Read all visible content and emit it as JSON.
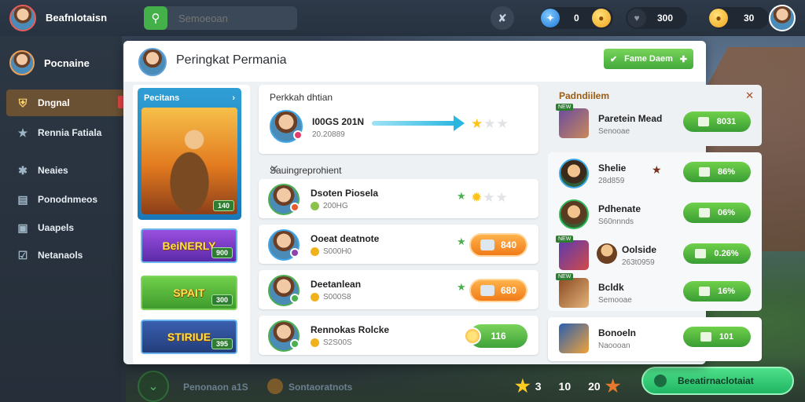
{
  "topbar": {
    "username": "Beafnlotaisn",
    "search_placeholder": "Semoeoan",
    "currency1": {
      "value": "0",
      "icon": "blue-gem-icon"
    },
    "currency2": {
      "value": "300",
      "icon": "heart-icon"
    },
    "currency3": {
      "value": "30",
      "icon": "gold-coin-icon"
    }
  },
  "sidebar": {
    "profile_label": "Pocnaine",
    "items": [
      {
        "label": "Dngnal",
        "icon": "shield-icon"
      },
      {
        "label": "Rennia Fatiala",
        "icon": "trophy-icon"
      },
      {
        "label": "Neaies",
        "icon": "gear-icon"
      },
      {
        "label": "Ponodnmeos",
        "icon": "book-icon"
      },
      {
        "label": "Uaapels",
        "icon": "box-icon"
      },
      {
        "label": "Netanaols",
        "icon": "checklist-icon"
      }
    ]
  },
  "panel": {
    "title": "Peringkat Permania",
    "header_button": "Fame Daem",
    "left": {
      "feature_title": "Pecitans",
      "feature_badge": "140",
      "promos": [
        {
          "label": "BeiNERLY",
          "badge": "900"
        },
        {
          "label": "SPAIT",
          "badge": "300"
        },
        {
          "label": "STIRIUE",
          "badge": "395"
        }
      ]
    },
    "top_card": {
      "title": "Perkkah dhtian",
      "name": "I00GS 201N",
      "sub": "20.20889",
      "stars_on": 1
    },
    "list": {
      "title": "Sauingreprohient",
      "rows": [
        {
          "name": "Dsoten Piosela",
          "sub": "200HG",
          "score": "",
          "stars_on": 1
        },
        {
          "name": "Ooeat deatnote",
          "sub": "S000H0",
          "score": "840"
        },
        {
          "name": "Deetanlean",
          "sub": "S000S8",
          "score": "680"
        },
        {
          "name": "Rennokas Rolcke",
          "sub": "S2S00S",
          "score": "116"
        }
      ]
    }
  },
  "right": {
    "title": "Padndiilem",
    "rows": [
      {
        "name": "Paretein Mead",
        "sub": "Senooae",
        "value": "8031"
      },
      {
        "name": "Shelie",
        "sub": "28d859",
        "value": "86%"
      },
      {
        "name": "Pdhenate",
        "sub": "S60nnnds",
        "value": "06%"
      },
      {
        "name": "Oolside",
        "sub": "263t0959",
        "value": "0.26%"
      },
      {
        "name": "Bcldk",
        "sub": "Semooae",
        "value": "16%"
      },
      {
        "name": "Bonoeln",
        "sub": "Naoooan",
        "value": "101"
      }
    ]
  },
  "bottombar": {
    "label1": "Penonaon a1S",
    "label2": "Sontaoratnots",
    "stat1": "3",
    "stat2": "10",
    "stat3": "20",
    "cta": "Beeatirnaclotaiat"
  },
  "colors": {
    "accent_green": "#43a93b",
    "accent_orange": "#f07c1a",
    "sidebar_active": "#6b5134"
  }
}
